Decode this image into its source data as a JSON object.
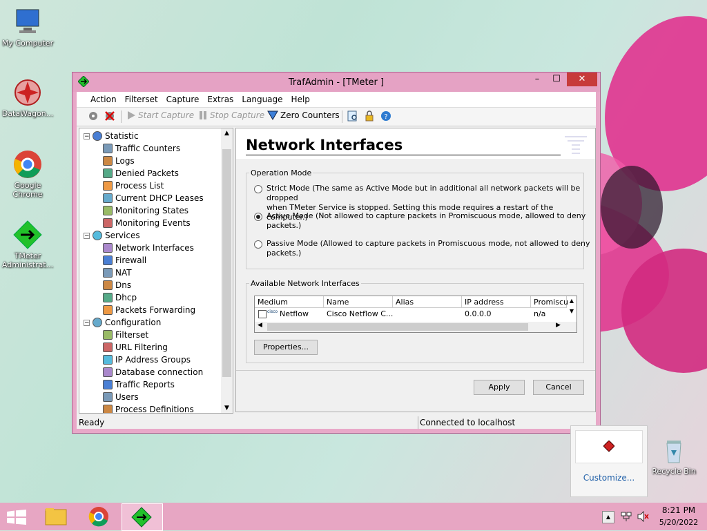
{
  "desktop": {
    "icons": [
      {
        "label": "My Computer"
      },
      {
        "label": "DataWagon..."
      },
      {
        "label": "Google Chrome"
      },
      {
        "label": "TMeter Administrat..."
      },
      {
        "label": "Recycle Bin"
      }
    ]
  },
  "window": {
    "title": "TrafAdmin - [TMeter ]",
    "controls": {
      "minimize": "–",
      "maximize": "☐",
      "close": "✕"
    },
    "menu": [
      "Action",
      "Filterset",
      "Capture",
      "Extras",
      "Language",
      "Help"
    ],
    "toolbar": {
      "start_capture": "Start Capture",
      "stop_capture": "Stop Capture",
      "zero_counters": "Zero Counters"
    },
    "tree": {
      "items": [
        {
          "label": "Statistic",
          "level": 0,
          "expander": "−"
        },
        {
          "label": "Traffic Counters",
          "level": 1
        },
        {
          "label": "Logs",
          "level": 1
        },
        {
          "label": "Denied Packets",
          "level": 1
        },
        {
          "label": "Process List",
          "level": 1
        },
        {
          "label": "Current DHCP Leases",
          "level": 1
        },
        {
          "label": "Monitoring States",
          "level": 1
        },
        {
          "label": "Monitoring Events",
          "level": 1
        },
        {
          "label": "Services",
          "level": 0,
          "expander": "−"
        },
        {
          "label": "Network Interfaces",
          "level": 1
        },
        {
          "label": "Firewall",
          "level": 1
        },
        {
          "label": "NAT",
          "level": 1
        },
        {
          "label": "Dns",
          "level": 1
        },
        {
          "label": "Dhcp",
          "level": 1
        },
        {
          "label": "Packets Forwarding",
          "level": 1
        },
        {
          "label": "Configuration",
          "level": 0,
          "expander": "−"
        },
        {
          "label": "Filterset",
          "level": 1
        },
        {
          "label": "URL Filtering",
          "level": 1
        },
        {
          "label": "IP Address Groups",
          "level": 1
        },
        {
          "label": "Database connection",
          "level": 1
        },
        {
          "label": "Traffic Reports",
          "level": 1
        },
        {
          "label": "Users",
          "level": 1
        },
        {
          "label": "Process Definitions",
          "level": 1
        }
      ]
    },
    "panel": {
      "heading": "Network Interfaces",
      "operation_mode": {
        "legend": "Operation Mode",
        "options": [
          {
            "line1": "Strict Mode (The same as Active Mode but in additional all network packets will be dropped",
            "line2": "when TMeter Service is stopped. Setting this mode requires a restart of the computer.)",
            "selected": false
          },
          {
            "line1": "Active Mode (Not allowed to capture packets in Promiscuous mode, allowed to deny packets.)",
            "line2": "",
            "selected": true
          },
          {
            "line1": "Passive Mode (Allowed to capture packets in Promiscuous mode, not allowed to deny",
            "line2": "packets.)",
            "selected": false
          }
        ]
      },
      "interfaces": {
        "legend": "Available Network Interfaces",
        "columns": [
          "Medium",
          "Name",
          "Alias",
          "IP address",
          "Promiscu"
        ],
        "rows": [
          {
            "medium": "Netflow",
            "name": "Cisco Netflow C...",
            "alias": "",
            "ip": "0.0.0.0",
            "promisc": "n/a",
            "checked": false
          }
        ]
      },
      "properties_button": "Properties...",
      "apply_button": "Apply",
      "cancel_button": "Cancel"
    },
    "status": {
      "left": "Ready",
      "right": "Connected to localhost"
    }
  },
  "notification": {
    "customize": "Customize..."
  },
  "taskbar": {
    "time": "8:21 PM",
    "date": "5/20/2022"
  },
  "colors": {
    "window_frame": "#e5a2c4",
    "close": "#c73b3b",
    "taskbar": "#e7a6c3"
  }
}
